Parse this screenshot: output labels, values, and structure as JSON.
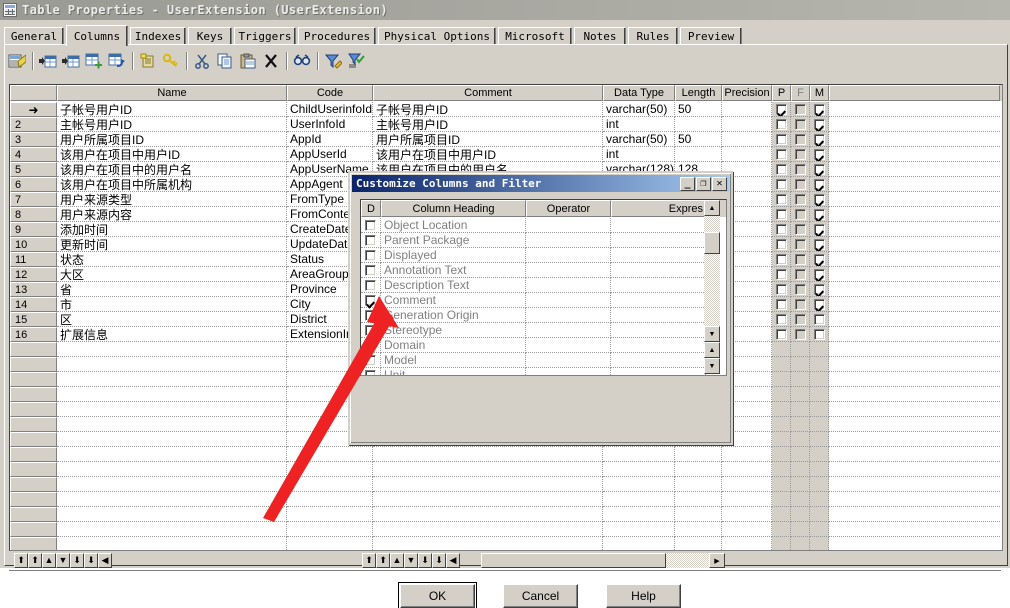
{
  "window": {
    "title": "Table Properties - UserExtension (UserExtension)",
    "icon": "table-icon"
  },
  "tabs": [
    {
      "label": "General",
      "active": false
    },
    {
      "label": "Columns",
      "active": true
    },
    {
      "label": "Indexes",
      "active": false
    },
    {
      "label": "Keys",
      "active": false
    },
    {
      "label": "Triggers",
      "active": false
    },
    {
      "label": "Procedures",
      "active": false
    },
    {
      "label": "Physical Options",
      "active": false
    },
    {
      "label": "Microsoft",
      "active": false
    },
    {
      "label": "Notes",
      "active": false
    },
    {
      "label": "Rules",
      "active": false
    },
    {
      "label": "Preview",
      "active": false
    }
  ],
  "toolbar": {
    "buttons": [
      {
        "name": "properties-icon",
        "title": "Properties"
      },
      {
        "name": "insert-row-icon",
        "title": "Insert a Row"
      },
      {
        "name": "add-row-icon",
        "title": "Add a Row"
      },
      {
        "name": "add-column-icon",
        "title": "Add a Column"
      },
      {
        "name": "replicate-icon",
        "title": "Replicate"
      },
      {
        "name": "new-note-icon",
        "title": "New"
      },
      {
        "name": "key-icon",
        "title": "Primary Key"
      },
      {
        "name": "cut-icon",
        "title": "Cut"
      },
      {
        "name": "copy-icon",
        "title": "Copy"
      },
      {
        "name": "paste-icon",
        "title": "Paste"
      },
      {
        "name": "delete-icon",
        "title": "Delete"
      },
      {
        "name": "find-icon",
        "title": "Find"
      },
      {
        "name": "customize-filter-icon",
        "title": "Customize Columns and Filter"
      },
      {
        "name": "apply-filter-icon",
        "title": "Apply Filter"
      }
    ]
  },
  "grid": {
    "headers": [
      "",
      "Name",
      "Code",
      "Comment",
      "Data Type",
      "Length",
      "Precision",
      "P",
      "F",
      "M"
    ],
    "rows": [
      {
        "n": "1",
        "current": true,
        "name": "子帐号用户ID",
        "code": "ChildUserinfoId",
        "comment": "子帐号用户ID",
        "type": "varchar(50)",
        "length": "50",
        "precision": "",
        "p": true,
        "f": false,
        "m": true
      },
      {
        "n": "2",
        "current": false,
        "name": "主帐号用户ID",
        "code": "UserInfoId",
        "comment": "主帐号用户ID",
        "type": "int",
        "length": "",
        "precision": "",
        "p": false,
        "f": false,
        "m": true
      },
      {
        "n": "3",
        "current": false,
        "name": "用户所属项目ID",
        "code": "AppId",
        "comment": "用户所属项目ID",
        "type": "varchar(50)",
        "length": "50",
        "precision": "",
        "p": false,
        "f": false,
        "m": true
      },
      {
        "n": "4",
        "current": false,
        "name": "该用户在项目中用户ID",
        "code": "AppUserId",
        "comment": "该用户在项目中用户ID",
        "type": "int",
        "length": "",
        "precision": "",
        "p": false,
        "f": false,
        "m": true
      },
      {
        "n": "5",
        "current": false,
        "name": "该用户在项目中的用户名",
        "code": "AppUserName",
        "comment": "该用户在项目中的用户名",
        "type": "varchar(128)",
        "length": "128",
        "precision": "",
        "p": false,
        "f": false,
        "m": true
      },
      {
        "n": "6",
        "current": false,
        "name": "该用户在项目中所属机构",
        "code": "AppAgent",
        "comment": "",
        "type": "",
        "length": "",
        "precision": "",
        "p": false,
        "f": false,
        "m": true
      },
      {
        "n": "7",
        "current": false,
        "name": "用户来源类型",
        "code": "FromType",
        "comment": "",
        "type": "",
        "length": "",
        "precision": "",
        "p": false,
        "f": false,
        "m": true
      },
      {
        "n": "8",
        "current": false,
        "name": "用户来源内容",
        "code": "FromContent",
        "comment": "",
        "type": "",
        "length": "",
        "precision": "",
        "p": false,
        "f": false,
        "m": true
      },
      {
        "n": "9",
        "current": false,
        "name": "添加时间",
        "code": "CreateDate",
        "comment": "",
        "type": "",
        "length": "",
        "precision": "",
        "p": false,
        "f": false,
        "m": true
      },
      {
        "n": "10",
        "current": false,
        "name": "更新时间",
        "code": "UpdateDate",
        "comment": "",
        "type": "",
        "length": "",
        "precision": "",
        "p": false,
        "f": false,
        "m": true
      },
      {
        "n": "11",
        "current": false,
        "name": "状态",
        "code": "Status",
        "comment": "",
        "type": "",
        "length": "",
        "precision": "",
        "p": false,
        "f": false,
        "m": true
      },
      {
        "n": "12",
        "current": false,
        "name": "大区",
        "code": "AreaGroup",
        "comment": "",
        "type": "",
        "length": "",
        "precision": "",
        "p": false,
        "f": false,
        "m": true
      },
      {
        "n": "13",
        "current": false,
        "name": "省",
        "code": "Province",
        "comment": "",
        "type": "",
        "length": "",
        "precision": "",
        "p": false,
        "f": false,
        "m": true
      },
      {
        "n": "14",
        "current": false,
        "name": "市",
        "code": "City",
        "comment": "",
        "type": "",
        "length": "",
        "precision": "",
        "p": false,
        "f": false,
        "m": true
      },
      {
        "n": "15",
        "current": false,
        "name": "区",
        "code": "District",
        "comment": "",
        "type": "",
        "length": "",
        "precision": "",
        "p": false,
        "f": false,
        "m": false
      },
      {
        "n": "16",
        "current": false,
        "name": "扩展信息",
        "code": "ExtensionInfo",
        "comment": "",
        "type": "",
        "length": "",
        "precision": "",
        "p": false,
        "f": false,
        "m": false
      }
    ],
    "current_row_marker": "➜",
    "empty_row_count": 16
  },
  "bottom_toolbar": {
    "buttons": [
      "move-to-top",
      "move-page-up",
      "move-up",
      "move-down",
      "move-page-down",
      "move-to-bottom",
      "move-left"
    ]
  },
  "dialog": {
    "title": "Customize Columns and Filter",
    "title_buttons": [
      {
        "name": "minimize-button",
        "glyph": "_"
      },
      {
        "name": "maximize-button",
        "glyph": "❐"
      },
      {
        "name": "close-button",
        "glyph": "✕"
      }
    ],
    "list_headers": [
      "D",
      "Column Heading",
      "Operator",
      "Expres"
    ],
    "items": [
      {
        "label": "Object Location",
        "checked": false
      },
      {
        "label": "Parent Package",
        "checked": false
      },
      {
        "label": "Displayed",
        "checked": false
      },
      {
        "label": "Annotation Text",
        "checked": false
      },
      {
        "label": "Description Text",
        "checked": false
      },
      {
        "label": "Comment",
        "checked": true
      },
      {
        "label": "Generation Origin",
        "checked": false
      },
      {
        "label": "Stereotype",
        "checked": false
      },
      {
        "label": "Domain",
        "checked": false
      },
      {
        "label": "Model",
        "checked": false
      },
      {
        "label": "Unit",
        "checked": false
      }
    ],
    "move_buttons": [
      "move-to-top",
      "move-page-up",
      "move-up",
      "move-down",
      "move-page-down",
      "move-to-bottom",
      "move-left"
    ],
    "buttons": [
      {
        "label": "OK",
        "default": true
      },
      {
        "label": "Cancel",
        "default": false
      },
      {
        "label": "Help",
        "default": false
      }
    ]
  },
  "annotation": {
    "type": "red-arrow",
    "color": "#ee2222",
    "points_to": "Comment checkbox in dialog list"
  }
}
